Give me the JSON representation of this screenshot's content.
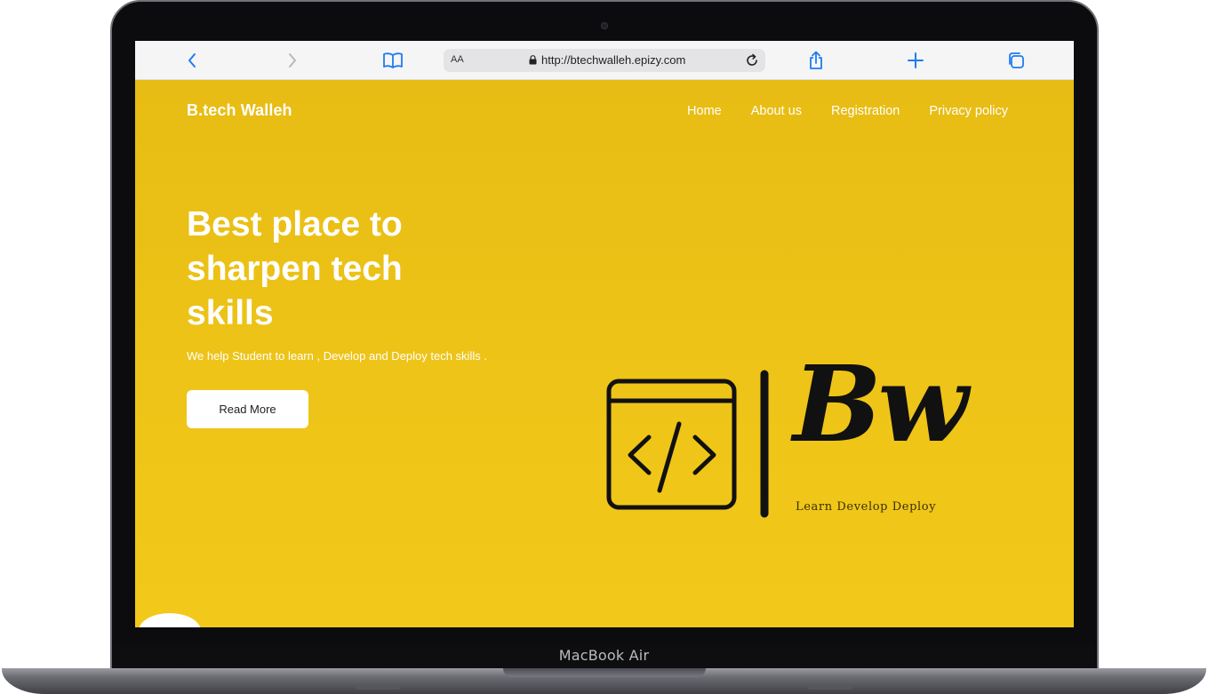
{
  "device": {
    "label": "MacBook Air"
  },
  "browser": {
    "text_size_label": "AA",
    "url": "http://btechwalleh.epizy.com",
    "icons": [
      "back-icon",
      "forward-icon",
      "bookmarks-icon",
      "lock-icon",
      "reload-icon",
      "share-icon",
      "new-tab-icon",
      "tabs-icon"
    ],
    "accent_color": "#1e7cf2"
  },
  "site": {
    "logo": "B.tech Walleh",
    "nav": [
      {
        "label": "Home"
      },
      {
        "label": "About us"
      },
      {
        "label": "Registration"
      },
      {
        "label": "Privacy policy"
      }
    ],
    "hero": {
      "title": "Best place to sharpen tech skills",
      "subtitle": "We help Student to learn , Develop and Deploy tech skills .",
      "cta_label": "Read More"
    },
    "brand_mark": {
      "monogram": "Bw",
      "tagline": "Learn Develop Deploy",
      "icon": "code-window-icon"
    },
    "colors": {
      "background": "#e9be15",
      "text": "#ffffff",
      "mark": "#111111"
    }
  }
}
